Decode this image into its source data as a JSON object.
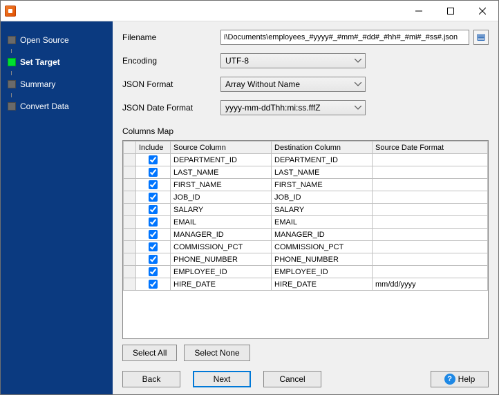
{
  "sidebar": {
    "steps": [
      {
        "label": "Open Source",
        "active": false
      },
      {
        "label": "Set Target",
        "active": true
      },
      {
        "label": "Summary",
        "active": false
      },
      {
        "label": "Convert Data",
        "active": false
      }
    ]
  },
  "form": {
    "filename_label": "Filename",
    "filename_value": "i\\Documents\\employees_#yyyy#_#mm#_#dd#_#hh#_#mi#_#ss#.json",
    "encoding_label": "Encoding",
    "encoding_value": "UTF-8",
    "json_format_label": "JSON Format",
    "json_format_value": "Array Without Name",
    "json_date_label": "JSON Date Format",
    "json_date_value": "yyyy-mm-ddThh:mi:ss.fffZ"
  },
  "columns_map_label": "Columns Map",
  "grid": {
    "headers": {
      "include": "Include",
      "source": "Source Column",
      "destination": "Destination Column",
      "source_date_format": "Source Date Format"
    },
    "rows": [
      {
        "include": true,
        "source": "DEPARTMENT_ID",
        "destination": "DEPARTMENT_ID",
        "fmt": ""
      },
      {
        "include": true,
        "source": "LAST_NAME",
        "destination": "LAST_NAME",
        "fmt": ""
      },
      {
        "include": true,
        "source": "FIRST_NAME",
        "destination": "FIRST_NAME",
        "fmt": ""
      },
      {
        "include": true,
        "source": "JOB_ID",
        "destination": "JOB_ID",
        "fmt": ""
      },
      {
        "include": true,
        "source": "SALARY",
        "destination": "SALARY",
        "fmt": ""
      },
      {
        "include": true,
        "source": "EMAIL",
        "destination": "EMAIL",
        "fmt": ""
      },
      {
        "include": true,
        "source": "MANAGER_ID",
        "destination": "MANAGER_ID",
        "fmt": ""
      },
      {
        "include": true,
        "source": "COMMISSION_PCT",
        "destination": "COMMISSION_PCT",
        "fmt": ""
      },
      {
        "include": true,
        "source": "PHONE_NUMBER",
        "destination": "PHONE_NUMBER",
        "fmt": ""
      },
      {
        "include": true,
        "source": "EMPLOYEE_ID",
        "destination": "EMPLOYEE_ID",
        "fmt": ""
      },
      {
        "include": true,
        "source": "HIRE_DATE",
        "destination": "HIRE_DATE",
        "fmt": "mm/dd/yyyy"
      }
    ]
  },
  "buttons": {
    "select_all": "Select All",
    "select_none": "Select None",
    "back": "Back",
    "next": "Next",
    "cancel": "Cancel",
    "help": "Help"
  }
}
